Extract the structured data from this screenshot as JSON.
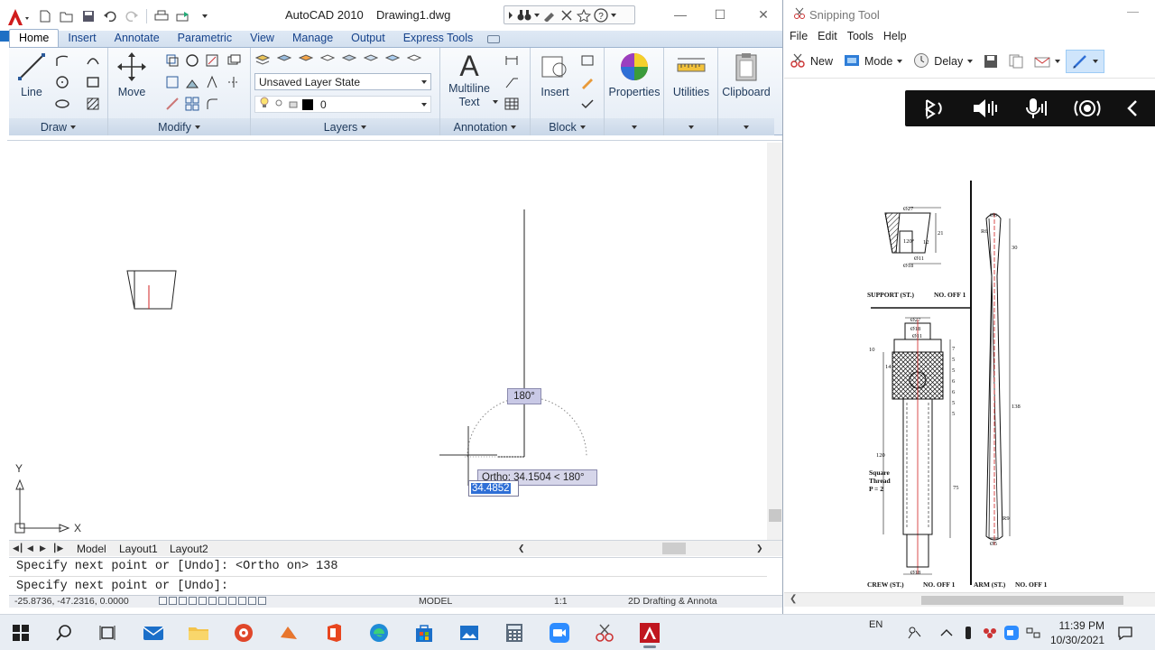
{
  "autocad": {
    "app_title": "AutoCAD 2010",
    "doc_title": "Drawing1.dwg",
    "ribbon_tabs": [
      "Home",
      "Insert",
      "Annotate",
      "Parametric",
      "View",
      "Manage",
      "Output",
      "Express Tools"
    ],
    "active_tab": "Home",
    "draw_panel": {
      "line_label": "Line",
      "title": "Draw"
    },
    "modify_panel": {
      "move_label": "Move",
      "title": "Modify"
    },
    "layers_panel": {
      "layer_state": "Unsaved Layer State",
      "current_layer": "0",
      "title": "Layers"
    },
    "annotation_panel": {
      "text_label_line1": "Multiline",
      "text_label_line2": "Text",
      "title": "Annotation"
    },
    "block_panel": {
      "insert_label": "Insert",
      "title": "Block"
    },
    "properties_label": "Properties",
    "utilities_label": "Utilities",
    "clipboard_label": "Clipboard",
    "tooltip_angle": "180°",
    "tooltip_ortho": "Ortho: 34.1504 < 180°",
    "dynamic_input": "34.4852",
    "ucs": {
      "y": "Y",
      "x": "X"
    },
    "layout_tabs": [
      "Model",
      "Layout1",
      "Layout2"
    ],
    "command_history": "Specify next point or [Undo]:  <Ortho on> 138",
    "command_prompt": "Specify next point or [Undo]:",
    "status": {
      "coords": "-25.8736, -47.2316, 0.0000",
      "space": "MODEL",
      "scale": "1:1",
      "workspace": "2D Drafting & Annota"
    }
  },
  "snipping_tool": {
    "title": "Snipping Tool",
    "menu": [
      "File",
      "Edit",
      "Tools",
      "Help"
    ],
    "toolbar": {
      "new": "New",
      "mode": "Mode",
      "delay": "Delay"
    },
    "drawing_labels": {
      "support": "SUPPORT (ST.)",
      "support_no": "NO. OFF 1",
      "screw": "CREW (ST.)",
      "screw_no": "NO. OFF 1",
      "arm": "ARM (ST.)",
      "arm_no": "NO. OFF 1",
      "square_thread_1": "Square",
      "square_thread_2": "Thread",
      "square_thread_3": "P = 2"
    }
  },
  "taskbar": {
    "lang": "EN",
    "time": "11:39 PM",
    "date": "10/30/2021"
  }
}
